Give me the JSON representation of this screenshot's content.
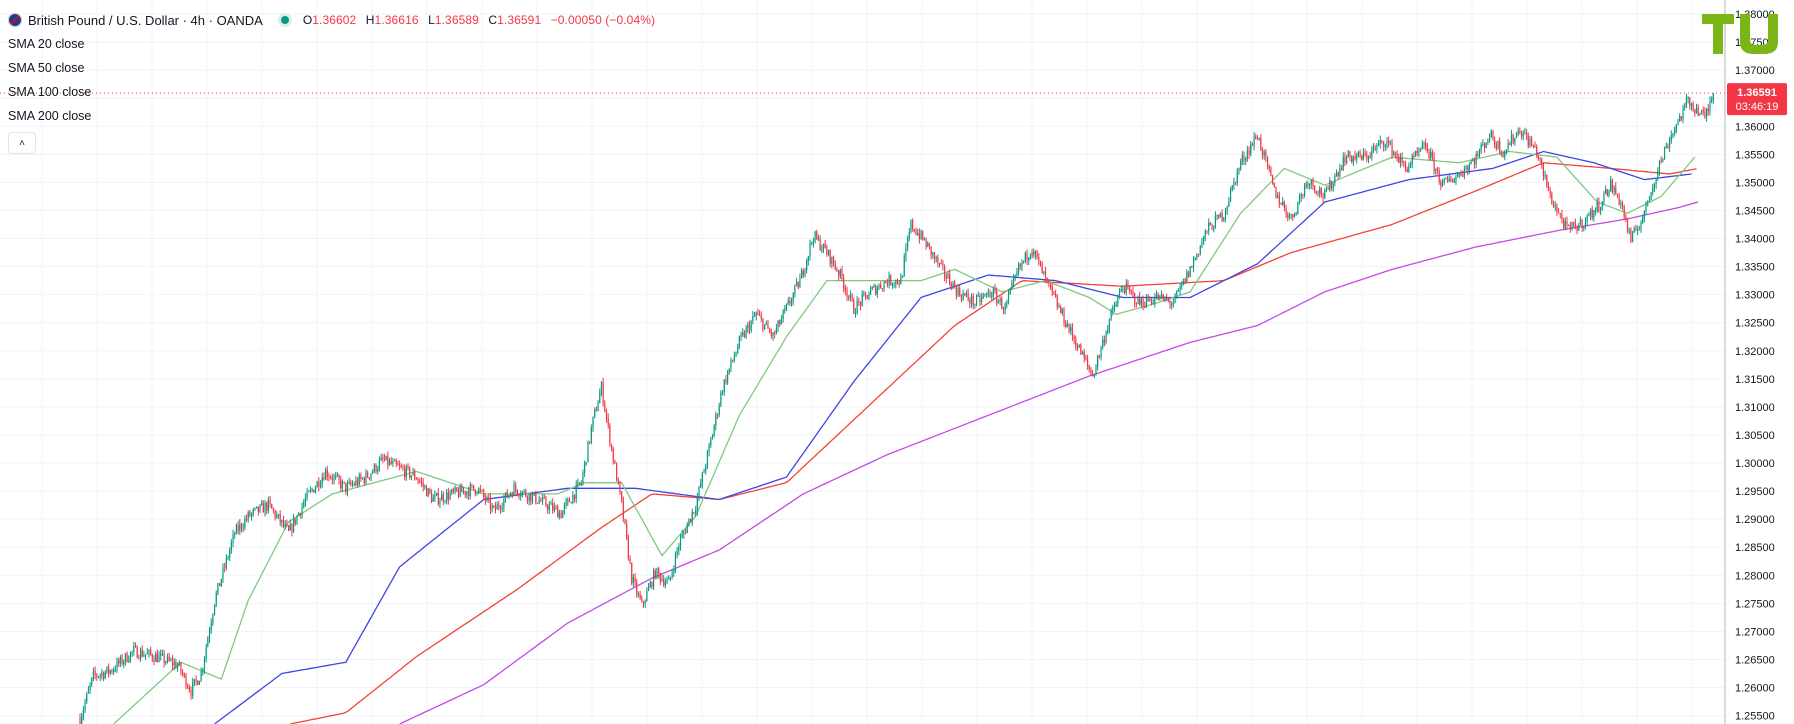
{
  "legend": {
    "symbol_title": "British Pound / U.S. Dollar · 4h · OANDA",
    "ohlc": {
      "open_label": "O",
      "open": "1.36602",
      "high_label": "H",
      "high": "1.36616",
      "low_label": "L",
      "low": "1.36589",
      "close_label": "C",
      "close": "1.36591",
      "change": "−0.00050 (−0.04%)"
    },
    "indicators": [
      "SMA 20 close",
      "SMA 50 close",
      "SMA 100 close",
      "SMA 200 close"
    ],
    "collapse_glyph": "˄"
  },
  "price_badge": {
    "price": "1.36591",
    "countdown": "03:46:19"
  },
  "logo_icon": "tu-logo-icon",
  "colors": {
    "up": "#089981",
    "down": "#f23645",
    "sma20": "#7fc97f",
    "sma50": "#3d45e6",
    "sma100": "#f44336",
    "sma200": "#c24be8",
    "grid": "#f0f3fa",
    "logo": "#7cb518"
  },
  "chart_data": {
    "type": "candlestick",
    "y_axis_ticks": [
      "1.38000",
      "1.37500",
      "1.37000",
      "1.36500",
      "1.36000",
      "1.35500",
      "1.35000",
      "1.34500",
      "1.34000",
      "1.33500",
      "1.33000",
      "1.32500",
      "1.32000",
      "1.31500",
      "1.31000",
      "1.30500",
      "1.30000",
      "1.29500",
      "1.29000",
      "1.28500",
      "1.28000",
      "1.27500",
      "1.27000",
      "1.26500",
      "1.26000",
      "1.25500"
    ],
    "ylim": [
      1.2535,
      1.3825
    ],
    "last_price": 1.36591,
    "price_path": [
      [
        0,
        1.2545
      ],
      [
        8,
        1.262
      ],
      [
        18,
        1.263
      ],
      [
        32,
        1.2665
      ],
      [
        45,
        1.2655
      ],
      [
        58,
        1.264
      ],
      [
        66,
        1.2595
      ],
      [
        72,
        1.2625
      ],
      [
        80,
        1.2755
      ],
      [
        92,
        1.2875
      ],
      [
        100,
        1.2905
      ],
      [
        112,
        1.2925
      ],
      [
        124,
        1.2875
      ],
      [
        134,
        1.2935
      ],
      [
        146,
        1.2985
      ],
      [
        158,
        1.2955
      ],
      [
        170,
        1.2975
      ],
      [
        180,
        1.3005
      ],
      [
        190,
        1.299
      ],
      [
        200,
        1.2975
      ],
      [
        210,
        1.2935
      ],
      [
        222,
        1.2945
      ],
      [
        236,
        1.2955
      ],
      [
        246,
        1.2915
      ],
      [
        258,
        1.2955
      ],
      [
        272,
        1.2935
      ],
      [
        286,
        1.291
      ],
      [
        298,
        1.2965
      ],
      [
        305,
        1.3075
      ],
      [
        310,
        1.3135
      ],
      [
        316,
        1.3025
      ],
      [
        322,
        1.2925
      ],
      [
        328,
        1.2795
      ],
      [
        334,
        1.2745
      ],
      [
        342,
        1.2805
      ],
      [
        350,
        1.2785
      ],
      [
        356,
        1.2855
      ],
      [
        366,
        1.2925
      ],
      [
        374,
        1.3025
      ],
      [
        382,
        1.3135
      ],
      [
        392,
        1.3215
      ],
      [
        402,
        1.3265
      ],
      [
        412,
        1.3225
      ],
      [
        420,
        1.3275
      ],
      [
        428,
        1.3325
      ],
      [
        436,
        1.3405
      ],
      [
        444,
        1.3375
      ],
      [
        452,
        1.3335
      ],
      [
        460,
        1.3275
      ],
      [
        470,
        1.3305
      ],
      [
        480,
        1.3325
      ],
      [
        488,
        1.3325
      ],
      [
        494,
        1.3425
      ],
      [
        502,
        1.3395
      ],
      [
        512,
        1.3345
      ],
      [
        522,
        1.3305
      ],
      [
        532,
        1.3285
      ],
      [
        542,
        1.3305
      ],
      [
        550,
        1.3275
      ],
      [
        558,
        1.3345
      ],
      [
        566,
        1.3385
      ],
      [
        574,
        1.3325
      ],
      [
        582,
        1.3275
      ],
      [
        592,
        1.3215
      ],
      [
        602,
        1.3155
      ],
      [
        612,
        1.3255
      ],
      [
        620,
        1.3315
      ],
      [
        630,
        1.3285
      ],
      [
        640,
        1.3295
      ],
      [
        650,
        1.3285
      ],
      [
        660,
        1.3345
      ],
      [
        670,
        1.3415
      ],
      [
        680,
        1.3445
      ],
      [
        690,
        1.3535
      ],
      [
        700,
        1.3585
      ],
      [
        710,
        1.3485
      ],
      [
        720,
        1.3435
      ],
      [
        730,
        1.3505
      ],
      [
        740,
        1.3475
      ],
      [
        752,
        1.3545
      ],
      [
        764,
        1.3545
      ],
      [
        776,
        1.3575
      ],
      [
        788,
        1.3525
      ],
      [
        800,
        1.3565
      ],
      [
        810,
        1.3495
      ],
      [
        820,
        1.3515
      ],
      [
        830,
        1.3545
      ],
      [
        838,
        1.3585
      ],
      [
        846,
        1.3555
      ],
      [
        856,
        1.3595
      ],
      [
        866,
        1.3555
      ],
      [
        874,
        1.3475
      ],
      [
        884,
        1.3415
      ],
      [
        892,
        1.3425
      ],
      [
        902,
        1.3455
      ],
      [
        910,
        1.3495
      ],
      [
        916,
        1.3465
      ],
      [
        922,
        1.3395
      ],
      [
        930,
        1.3445
      ],
      [
        938,
        1.3525
      ],
      [
        946,
        1.3585
      ],
      [
        956,
        1.3645
      ],
      [
        966,
        1.3615
      ],
      [
        971,
        1.36591
      ]
    ],
    "sma20_path": [
      [
        20,
        1.2535
      ],
      [
        60,
        1.2645
      ],
      [
        84,
        1.2615
      ],
      [
        100,
        1.2755
      ],
      [
        124,
        1.2895
      ],
      [
        150,
        1.2945
      ],
      [
        200,
        1.2985
      ],
      [
        240,
        1.2945
      ],
      [
        284,
        1.2945
      ],
      [
        300,
        1.2965
      ],
      [
        322,
        1.2965
      ],
      [
        346,
        1.2835
      ],
      [
        366,
        1.2905
      ],
      [
        392,
        1.3085
      ],
      [
        420,
        1.3225
      ],
      [
        444,
        1.3325
      ],
      [
        472,
        1.3325
      ],
      [
        500,
        1.3325
      ],
      [
        520,
        1.3345
      ],
      [
        548,
        1.3305
      ],
      [
        574,
        1.3325
      ],
      [
        600,
        1.3295
      ],
      [
        616,
        1.3265
      ],
      [
        640,
        1.3285
      ],
      [
        660,
        1.3305
      ],
      [
        690,
        1.3445
      ],
      [
        716,
        1.3525
      ],
      [
        740,
        1.3495
      ],
      [
        780,
        1.3545
      ],
      [
        820,
        1.3535
      ],
      [
        850,
        1.3555
      ],
      [
        878,
        1.3545
      ],
      [
        902,
        1.3465
      ],
      [
        920,
        1.3445
      ],
      [
        940,
        1.3475
      ],
      [
        960,
        1.3545
      ]
    ],
    "sma50_path": [
      [
        80,
        1.2535
      ],
      [
        120,
        1.2625
      ],
      [
        158,
        1.2645
      ],
      [
        190,
        1.2815
      ],
      [
        240,
        1.2935
      ],
      [
        290,
        1.2955
      ],
      [
        330,
        1.2955
      ],
      [
        380,
        1.2935
      ],
      [
        420,
        1.2975
      ],
      [
        460,
        1.3145
      ],
      [
        500,
        1.3295
      ],
      [
        540,
        1.3335
      ],
      [
        580,
        1.3325
      ],
      [
        620,
        1.3295
      ],
      [
        660,
        1.3295
      ],
      [
        700,
        1.3355
      ],
      [
        740,
        1.3465
      ],
      [
        790,
        1.3505
      ],
      [
        840,
        1.3525
      ],
      [
        870,
        1.3555
      ],
      [
        900,
        1.3535
      ],
      [
        930,
        1.3505
      ],
      [
        958,
        1.3515
      ]
    ],
    "sma100_path": [
      [
        125,
        1.2535
      ],
      [
        158,
        1.2555
      ],
      [
        200,
        1.2655
      ],
      [
        260,
        1.2775
      ],
      [
        310,
        1.2885
      ],
      [
        340,
        1.2945
      ],
      [
        380,
        1.2935
      ],
      [
        420,
        1.2965
      ],
      [
        470,
        1.3105
      ],
      [
        520,
        1.3245
      ],
      [
        560,
        1.3325
      ],
      [
        620,
        1.3315
      ],
      [
        680,
        1.3325
      ],
      [
        720,
        1.3375
      ],
      [
        780,
        1.3425
      ],
      [
        830,
        1.3485
      ],
      [
        870,
        1.3535
      ],
      [
        910,
        1.3525
      ],
      [
        945,
        1.3515
      ],
      [
        962,
        1.3525
      ]
    ],
    "sma200_path": [
      [
        190,
        1.2535
      ],
      [
        240,
        1.2605
      ],
      [
        290,
        1.2715
      ],
      [
        340,
        1.2795
      ],
      [
        380,
        1.2845
      ],
      [
        430,
        1.2945
      ],
      [
        480,
        1.3015
      ],
      [
        540,
        1.3085
      ],
      [
        600,
        1.3155
      ],
      [
        660,
        1.3215
      ],
      [
        700,
        1.3245
      ],
      [
        740,
        1.3305
      ],
      [
        780,
        1.3345
      ],
      [
        830,
        1.3385
      ],
      [
        880,
        1.3415
      ],
      [
        920,
        1.3435
      ],
      [
        950,
        1.3455
      ],
      [
        962,
        1.3465
      ]
    ]
  }
}
